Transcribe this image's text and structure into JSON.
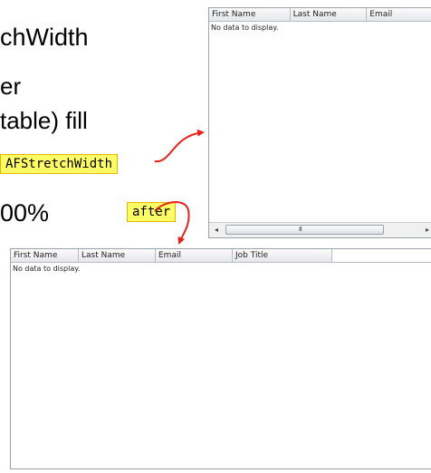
{
  "slide": {
    "line1": "chWidth",
    "line2": "er",
    "line3": "table) fill",
    "line4": "00%",
    "callout_name": "AFStretchWidth",
    "callout_after": "after"
  },
  "grid_before": {
    "columns": [
      "First Name",
      "Last Name",
      "Email"
    ],
    "empty_message": "No data to display.",
    "scroll_left": "◂",
    "scroll_right": "▸",
    "thumb_grip": "III"
  },
  "grid_after": {
    "columns": [
      "First Name",
      "Last Name",
      "Email",
      "Job Title",
      ""
    ],
    "empty_message": "No data to display."
  },
  "colors": {
    "callout_fill": "#ffff66",
    "arrow": "#e8201a"
  }
}
